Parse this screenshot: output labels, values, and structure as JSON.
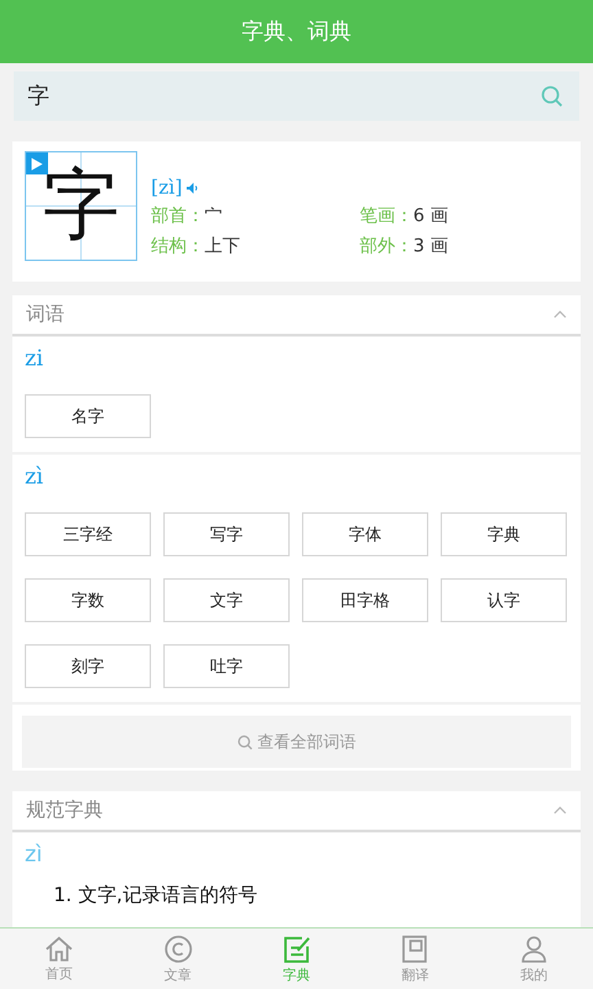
{
  "header": {
    "title": "字典、词典"
  },
  "search": {
    "value": "字"
  },
  "character": {
    "glyph": "字",
    "pinyin": "[zì]",
    "fields": [
      {
        "label": "部首：",
        "value": "宀"
      },
      {
        "label": "笔画：",
        "value": "6 画"
      },
      {
        "label": "结构：",
        "value": "上下"
      },
      {
        "label": "部外：",
        "value": "3 画"
      }
    ]
  },
  "words": {
    "title": "词语",
    "expanded": true,
    "groups": [
      {
        "pinyin": "zi",
        "items": [
          "名字"
        ]
      },
      {
        "pinyin": "zì",
        "items": [
          "三字经",
          "写字",
          "字体",
          "字典",
          "字数",
          "文字",
          "田字格",
          "认字",
          "刻字",
          "吐字"
        ]
      }
    ],
    "more": "查看全部词语"
  },
  "dictionary": {
    "title": "规范字典",
    "expanded": true,
    "pinyin": "zì",
    "definitions": [
      "1. 文字,记录语言的符号"
    ]
  },
  "nav": [
    {
      "label": "首页",
      "selected": false
    },
    {
      "label": "文章",
      "selected": false
    },
    {
      "label": "字典",
      "selected": true
    },
    {
      "label": "翻译",
      "selected": false
    },
    {
      "label": "我的",
      "selected": false
    }
  ]
}
